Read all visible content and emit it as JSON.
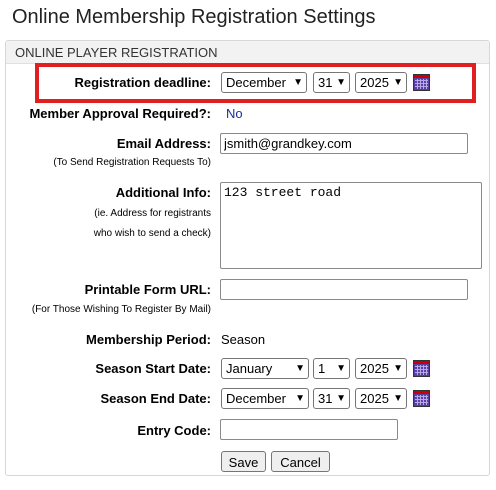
{
  "page": {
    "title": "Online Membership Registration Settings"
  },
  "panel": {
    "header": "ONLINE PLAYER REGISTRATION"
  },
  "form": {
    "deadline": {
      "label": "Registration deadline:",
      "month": "December",
      "day": "31",
      "year": "2025"
    },
    "approval": {
      "label": "Member Approval Required?:",
      "value": "No"
    },
    "email": {
      "label": "Email Address:",
      "sub": "(To Send Registration Requests To)",
      "value": "jsmith@grandkey.com"
    },
    "info": {
      "label": "Additional Info:",
      "sub1": "(ie. Address for registrants",
      "sub2": "who wish to send a check)",
      "value": "123 street road"
    },
    "printable": {
      "label": "Printable Form URL:",
      "sub": "(For Those Wishing To Register By Mail)",
      "value": ""
    },
    "period": {
      "label": "Membership Period:",
      "value": "Season"
    },
    "start": {
      "label": "Season Start Date:",
      "month": "January",
      "day": "1",
      "year": "2025"
    },
    "end": {
      "label": "Season End Date:",
      "month": "December",
      "day": "31",
      "year": "2025"
    },
    "entry": {
      "label": "Entry Code:",
      "value": ""
    },
    "save_label": "Save",
    "cancel_label": "Cancel"
  },
  "icons": {
    "calendar": "calendar-icon",
    "dropdown": "chevron-down-icon"
  },
  "colors": {
    "highlight": "#e02020",
    "link": "#1b2e9c",
    "header_bg": "#f2f2f2"
  }
}
